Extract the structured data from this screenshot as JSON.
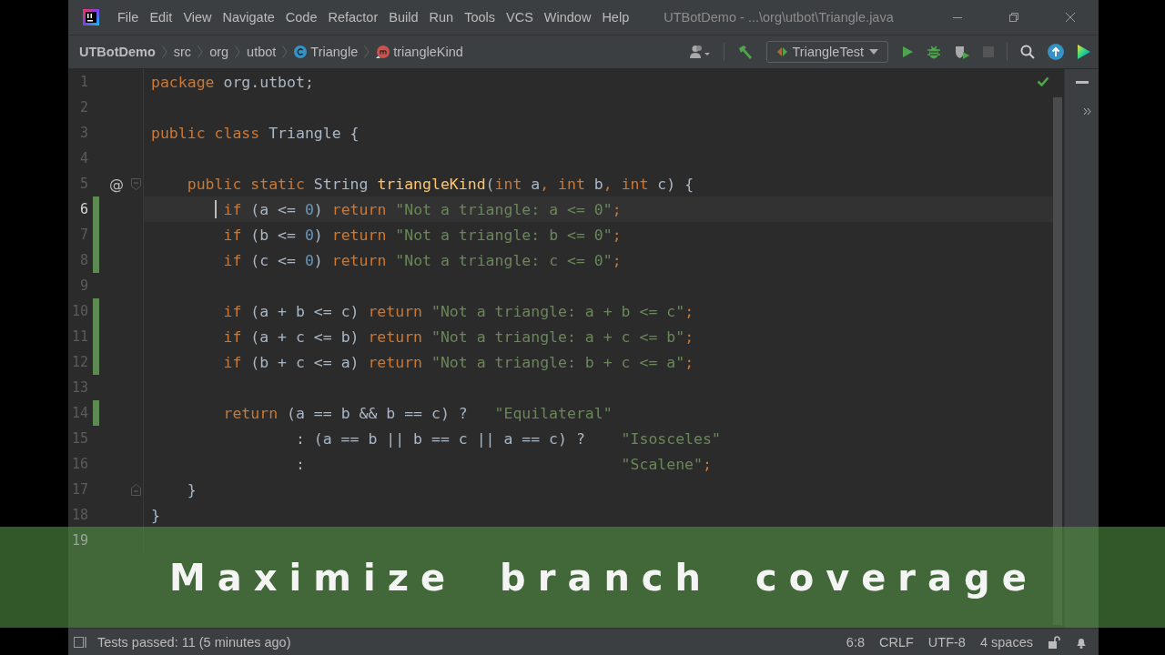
{
  "window": {
    "title": "UTBotDemo - ...\\org\\utbot\\Triangle.java"
  },
  "menu": [
    "File",
    "Edit",
    "View",
    "Navigate",
    "Code",
    "Refactor",
    "Build",
    "Run",
    "Tools",
    "VCS",
    "Window",
    "Help"
  ],
  "breadcrumbs": [
    {
      "label": "UTBotDemo",
      "kind": "project"
    },
    {
      "label": "src",
      "kind": "folder"
    },
    {
      "label": "org",
      "kind": "folder"
    },
    {
      "label": "utbot",
      "kind": "folder"
    },
    {
      "label": "Triangle",
      "kind": "class"
    },
    {
      "label": "triangleKind",
      "kind": "method"
    }
  ],
  "run_config": {
    "label": "TriangleTest"
  },
  "editor": {
    "lines": [
      {
        "number": "1",
        "covered": false,
        "current": false,
        "tokens": [
          {
            "kind": "kw",
            "text": "package"
          },
          {
            "kind": "plain",
            "text": " org.utbot;"
          }
        ]
      },
      {
        "number": "2",
        "covered": false,
        "current": false
      },
      {
        "number": "3",
        "covered": false,
        "current": false,
        "tokens": [
          {
            "kind": "kw",
            "text": "public class"
          },
          {
            "kind": "plain",
            "text": " Triangle {"
          }
        ]
      },
      {
        "number": "4",
        "covered": false,
        "current": false
      },
      {
        "number": "5",
        "covered": false,
        "current": false,
        "fold": {
          "kind": "start"
        },
        "annotation": "@",
        "tokens": [
          {
            "kind": "kw",
            "text": "    public static"
          },
          {
            "kind": "plain",
            "text": " String "
          },
          {
            "kind": "method",
            "text": "triangleKind"
          },
          {
            "kind": "plain",
            "text": "("
          },
          {
            "kind": "kw",
            "text": "int"
          },
          {
            "kind": "plain",
            "text": " a"
          },
          {
            "kind": "kw",
            "text": ", int"
          },
          {
            "kind": "plain",
            "text": " b"
          },
          {
            "kind": "kw",
            "text": ", int"
          },
          {
            "kind": "plain",
            "text": " c) {"
          }
        ]
      },
      {
        "number": "6",
        "covered": true,
        "current": true,
        "tokens": [
          {
            "kind": "kw",
            "text": "        if"
          },
          {
            "kind": "plain",
            "text": " (a <= "
          },
          {
            "kind": "num",
            "text": "0"
          },
          {
            "kind": "plain",
            "text": ") "
          },
          {
            "kind": "kw",
            "text": "return"
          },
          {
            "kind": "str",
            "text": " \"Not a triangle: a <= 0\""
          },
          {
            "kind": "kw",
            "text": ";"
          }
        ]
      },
      {
        "number": "7",
        "covered": true,
        "current": false,
        "tokens": [
          {
            "kind": "kw",
            "text": "        if"
          },
          {
            "kind": "plain",
            "text": " (b <= "
          },
          {
            "kind": "num",
            "text": "0"
          },
          {
            "kind": "plain",
            "text": ") "
          },
          {
            "kind": "kw",
            "text": "return"
          },
          {
            "kind": "str",
            "text": " \"Not a triangle: b <= 0\""
          },
          {
            "kind": "kw",
            "text": ";"
          }
        ]
      },
      {
        "number": "8",
        "covered": true,
        "current": false,
        "tokens": [
          {
            "kind": "kw",
            "text": "        if"
          },
          {
            "kind": "plain",
            "text": " (c <= "
          },
          {
            "kind": "num",
            "text": "0"
          },
          {
            "kind": "plain",
            "text": ") "
          },
          {
            "kind": "kw",
            "text": "return"
          },
          {
            "kind": "str",
            "text": " \"Not a triangle: c <= 0\""
          },
          {
            "kind": "kw",
            "text": ";"
          }
        ]
      },
      {
        "number": "9",
        "covered": false,
        "current": false
      },
      {
        "number": "10",
        "covered": true,
        "current": false,
        "tokens": [
          {
            "kind": "kw",
            "text": "        if"
          },
          {
            "kind": "plain",
            "text": " (a + b <= c) "
          },
          {
            "kind": "kw",
            "text": "return"
          },
          {
            "kind": "str",
            "text": " \"Not a triangle: a + b <= c\""
          },
          {
            "kind": "kw",
            "text": ";"
          }
        ]
      },
      {
        "number": "11",
        "covered": true,
        "current": false,
        "tokens": [
          {
            "kind": "kw",
            "text": "        if"
          },
          {
            "kind": "plain",
            "text": " (a + c <= b) "
          },
          {
            "kind": "kw",
            "text": "return"
          },
          {
            "kind": "str",
            "text": " \"Not a triangle: a + c <= b\""
          },
          {
            "kind": "kw",
            "text": ";"
          }
        ]
      },
      {
        "number": "12",
        "covered": true,
        "current": false,
        "tokens": [
          {
            "kind": "kw",
            "text": "        if"
          },
          {
            "kind": "plain",
            "text": " (b + c <= a) "
          },
          {
            "kind": "kw",
            "text": "return"
          },
          {
            "kind": "str",
            "text": " \"Not a triangle: b + c <= a\""
          },
          {
            "kind": "kw",
            "text": ";"
          }
        ]
      },
      {
        "number": "13",
        "covered": false,
        "current": false
      },
      {
        "number": "14",
        "covered": true,
        "current": false,
        "tokens": [
          {
            "kind": "kw",
            "text": "        return"
          },
          {
            "kind": "plain",
            "text": " (a == b && b == c) ?"
          },
          {
            "kind": "str",
            "text": "   \"Equilateral\""
          }
        ]
      },
      {
        "number": "15",
        "covered": false,
        "current": false,
        "tokens": [
          {
            "kind": "plain",
            "text": "                : (a == b || b == c || a == c) ?"
          },
          {
            "kind": "str",
            "text": "    \"Isosceles\""
          }
        ]
      },
      {
        "number": "16",
        "covered": false,
        "current": false,
        "tokens": [
          {
            "kind": "plain",
            "text": "                :"
          },
          {
            "kind": "str",
            "text": "                                   \"Scalene\""
          },
          {
            "kind": "kw",
            "text": ";"
          }
        ]
      },
      {
        "number": "17",
        "covered": false,
        "current": false,
        "fold": {
          "kind": "end"
        },
        "tokens": [
          {
            "kind": "plain",
            "text": "    }"
          }
        ]
      },
      {
        "number": "18",
        "covered": false,
        "current": false,
        "tokens": [
          {
            "kind": "plain",
            "text": "}"
          }
        ]
      },
      {
        "number": "19",
        "covered": false,
        "current": false
      }
    ]
  },
  "caption": "Maximize branch coverage",
  "status_bar": {
    "message": "Tests passed: 11 (5 minutes ago)",
    "position": "6:8",
    "line_separator": "CRLF",
    "encoding": "UTF-8",
    "indent": "4 spaces"
  }
}
